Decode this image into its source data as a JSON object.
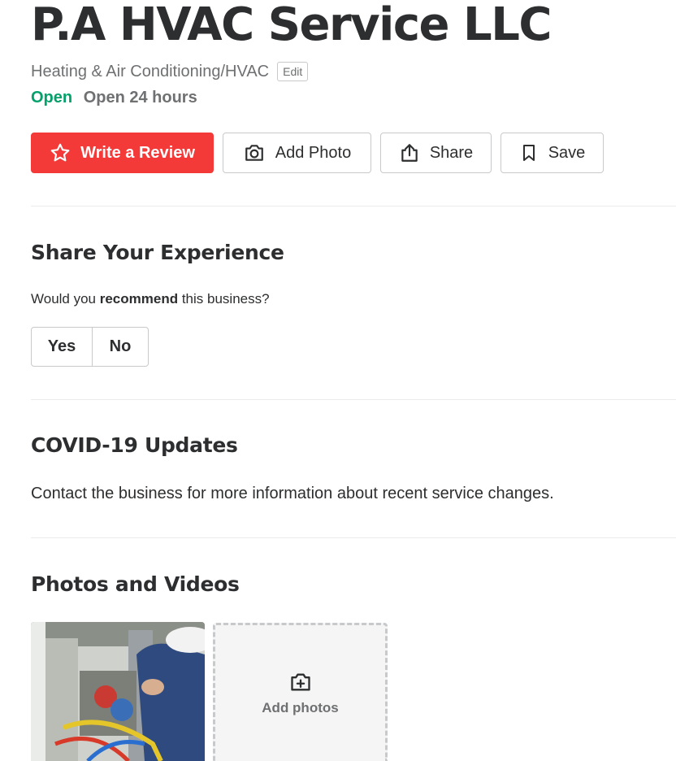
{
  "business": {
    "name": "P.A HVAC Service LLC",
    "category": "Heating & Air Conditioning/HVAC",
    "edit_label": "Edit",
    "open_status": "Open",
    "hours": "Open 24 hours"
  },
  "actions": {
    "write_review": "Write a Review",
    "add_photo": "Add Photo",
    "share": "Share",
    "save": "Save"
  },
  "experience": {
    "title": "Share Your Experience",
    "question_prefix": "Would you ",
    "question_bold": "recommend",
    "question_suffix": " this business?",
    "yes_label": "Yes",
    "no_label": "No"
  },
  "covid": {
    "title": "COVID-19 Updates",
    "text": "Contact the business for more information about recent service changes."
  },
  "photos": {
    "title": "Photos and Videos",
    "add_label": "Add photos"
  },
  "colors": {
    "primary": "#f43939",
    "open": "#04a16b",
    "text": "#2d2e2f",
    "muted": "#6e7072"
  },
  "icons": [
    "star-icon",
    "camera-icon",
    "share-icon",
    "bookmark-icon",
    "add-photo-icon"
  ]
}
